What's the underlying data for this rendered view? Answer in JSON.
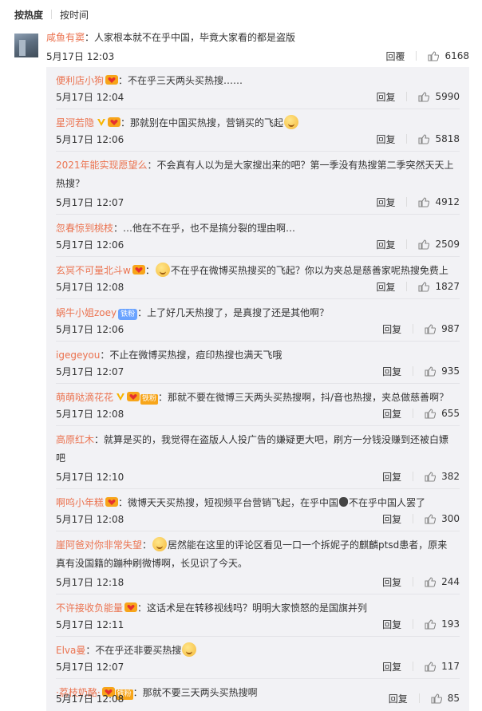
{
  "sort": {
    "hot": "按热度",
    "time": "按时间"
  },
  "top": {
    "user": "咸鱼有窦",
    "text": "：人家根本就不在乎中国，毕竟大家看的都是盗版",
    "time": "5月17日 12:03",
    "reply": "回覆",
    "likes": "6168"
  },
  "replies": [
    {
      "user": "便利店小狗",
      "badges": [
        "heart"
      ],
      "text": "：不在乎三天两头买热搜……",
      "time": "5月17日 12:04",
      "reply": "回复",
      "likes": "5990"
    },
    {
      "user": "星河若隐",
      "badges": [
        "v",
        "heart"
      ],
      "text": "：那就别在中国买热搜，营销买的飞起",
      "emo_after": true,
      "time": "5月17日 12:06",
      "reply": "回复",
      "likes": "5818"
    },
    {
      "user": "2021年能实现愿望么",
      "badges": [],
      "text": "：不会真有人以为是大家搜出来的吧？第一季没有热搜第二季突然天天上",
      "text2": "热搜？",
      "time": "5月17日 12:07",
      "reply": "回复",
      "likes": "4912"
    },
    {
      "user": "忽春惊到桃枝",
      "badges": [],
      "text": "：…他在不在乎，也不是搞分裂的理由啊…",
      "time": "5月17日 12:06",
      "reply": "回复",
      "likes": "2509"
    },
    {
      "user": "玄冥不可量北斗w",
      "badges": [
        "heart"
      ],
      "emo_before": true,
      "text": "不在乎在微博买热搜买的飞起？你以为夹总是慈善家呢热搜免费上",
      "time": "5月17日 12:08",
      "reply": "回复",
      "likes": "1827"
    },
    {
      "user": "蜗牛小姐zoey",
      "badges": [
        "fan"
      ],
      "fan_label": "铁粉",
      "text": "：上了好几天热搜了，是真搜了还是其他啊？",
      "time": "5月17日 12:06",
      "reply": "回复",
      "likes": "987"
    },
    {
      "user": "igegeyou",
      "badges": [],
      "text": "：不止在微博买热搜，痘印热搜也满天飞哦",
      "time": "5月17日 12:07",
      "reply": "回复",
      "likes": "935"
    },
    {
      "user": "萌萌哒滴花花",
      "badges": [
        "v",
        "heartfan"
      ],
      "fan_label": "铁粉",
      "text": "：那就不要在微博三天两头买热搜啊，抖/音也热搜，夹总做慈善啊？",
      "time": "5月17日 12:08",
      "reply": "回复",
      "likes": "655"
    },
    {
      "user": "高原红木",
      "badges": [],
      "text": "：就算是买的，我觉得在盗版人人投广告的嫌疑更大吧，刷方一分钱没赚到还被白嫖",
      "text2": "吧",
      "time": "5月17日 12:10",
      "reply": "回复",
      "likes": "382"
    },
    {
      "user": "啊呜小年糕",
      "badges": [
        "heart"
      ],
      "text": "：微博天天买热搜，短视频平台营销飞起，在乎中国",
      "money": true,
      "text_after": "不在乎中国人罢了",
      "time": "5月17日 12:08",
      "reply": "回复",
      "likes": "300"
    },
    {
      "user": "崖阿爸对你非常失望",
      "badges": [],
      "emo_before": true,
      "text": "居然能在这里的评论区看见一口一个拆妮子的麒麟ptsd患者，原来",
      "text2": "真有没国籍的蹦种刷微博啊，长见识了今天。",
      "time": "5月17日 12:18",
      "reply": "回复",
      "likes": "244"
    },
    {
      "user": "不许接收负能量",
      "badges": [
        "heart"
      ],
      "text": "：这话术是在转移视线吗？明明大家愤怒的是国旗并列",
      "time": "5月17日 12:11",
      "reply": "回复",
      "likes": "193"
    },
    {
      "user": "Elva曼",
      "badges": [],
      "text": "：不在乎还非要买热搜",
      "emo_after": true,
      "time": "5月17日 12:07",
      "reply": "回复",
      "likes": "117"
    },
    {
      "user": "·荔枝奶酪·",
      "badges": [
        "heartfan"
      ],
      "fan_label": "铁粉",
      "text": "：那就不要三天两头买热搜啊",
      "time": "5月17日 12:08",
      "reply": "回复",
      "likes": "85"
    }
  ],
  "colors": {
    "username": "#eb7350",
    "text": "#333333",
    "reply_bg": "#f2f2f5"
  }
}
